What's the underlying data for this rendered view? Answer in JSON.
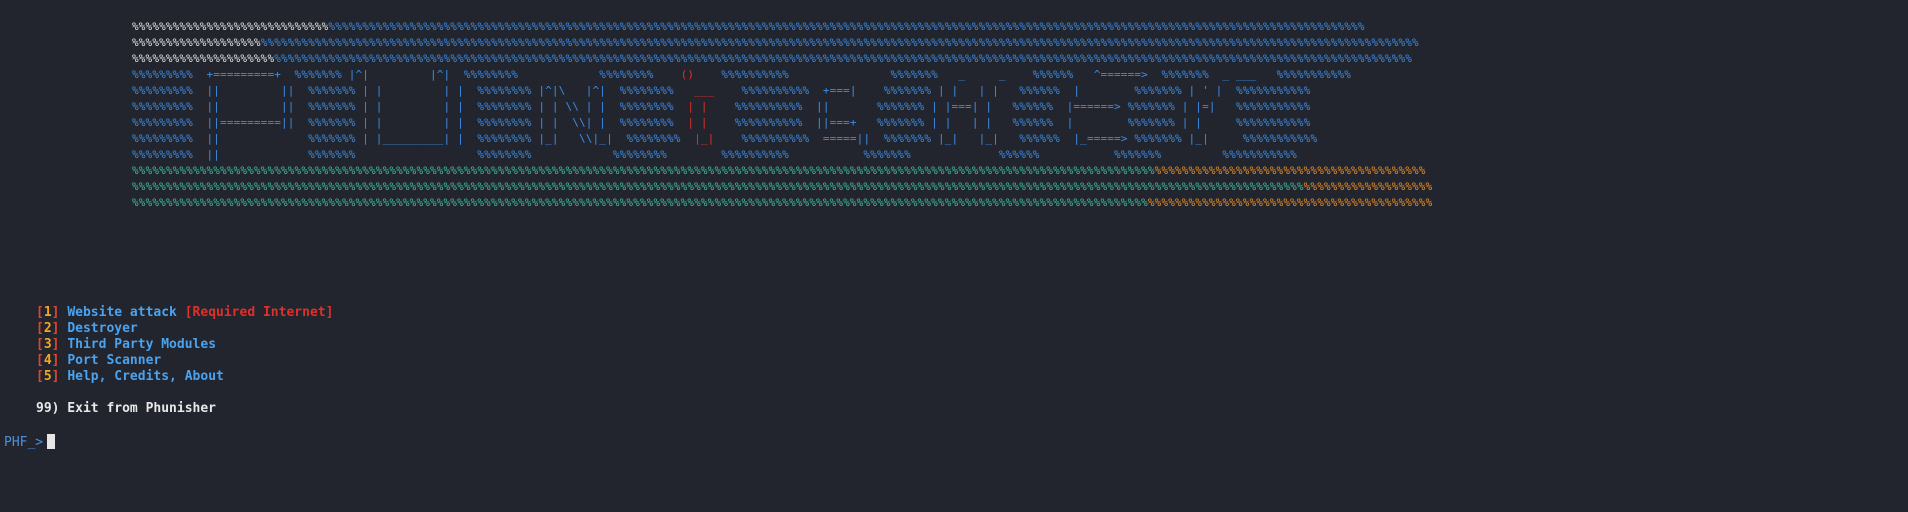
{
  "banner": {
    "colors": {
      "white": "#e6e6e6",
      "blue": "#3b8eea",
      "red": "#e0302a",
      "green": "#3fbf9f",
      "orange": "#f09020"
    },
    "rows": [
      [
        [
          "w",
          "%%%%%%%%%%%%%%%%%%%%%%%%%%%%%"
        ],
        [
          "b",
          "%%%%%%%%%%%%%%%%%%%%%%%%%%%%%%%%%%%%%%%%%%%%%%%%%%%%%%%%%%%%%%%%%%%%%%%%%%%%%%%%%%%%%%%%%%%%%%%%%%%%%%%%%%%%%%%%%%%%%%%%%%%%%%%%%%%%%%%%%%%%%%%%%%%%%%%%%"
        ]
      ],
      [
        [
          "w",
          "%%%%%%%%%%%%%%%%%%%"
        ],
        [
          "b",
          "%%%%%%%%%%%%%%%%%%%%%%%%%%%%%%%%%%%%%%%%%%%%%%%%%%%%%%%%%%%%%%%%%%%%%%%%%%%%%%%%%%%%%%%%%%%%%%%%%%%%%%%%%%%%%%%%%%%%%%%%%%%%%%%%%%%%%%%%%%%%%%%%%%%%%%%%%%%%%%%%%%%%%%%%%%%"
        ]
      ],
      [
        [
          "w",
          "%%%%%%%%%%%%%%%%%%%%%"
        ],
        [
          "b",
          "%%%%%%%%%%%%%%%%%%%%%%%%%%%%%%%%%%%%%%%%%%%%%%%%%%%%%%%%%%%%%%%%%%%%%%%%%%%%%%%%%%%%%%%%%%%%%%%%%%%%%%%%%%%%%%%%%%%%%%%%%%%%%%%%%%%%%%%%%%%%%%%%%%%%%%%%%%%%%%%%%%%%%%%%"
        ]
      ],
      [
        [
          "b",
          "%%%%%%%%%  +=========+  %%%%%%% |^|         |^|  %%%%%%%%            %%%%%%%%    "
        ],
        [
          "r",
          "()"
        ],
        [
          "b",
          "    %%%%%%%%%%   "
        ],
        [
          "b",
          "            %%%%%%%   _     _    %%%%%%   ^======>  %%%%%%%  _ ___   %%%%%%%%%%%"
        ]
      ],
      [
        [
          "b",
          "%%%%%%%%%  ||         ||  %%%%%%% | |         | |  %%%%%%%% |^|\\   |^|  %%%%%%%%   "
        ],
        [
          "r",
          "___"
        ],
        [
          "b",
          "    %%%%%%%%%%  +===|    %%%%%%% | |   | |   %%%%%%  |        %%%%%%% | ' |  %%%%%%%%%%%"
        ]
      ],
      [
        [
          "b",
          "%%%%%%%%%  ||         ||  %%%%%%% | |         | |  %%%%%%%% | | \\\\ | |  %%%%%%%%  "
        ],
        [
          "r",
          "| |"
        ],
        [
          "b",
          "    %%%%%%%%%%  ||       %%%%%%% | |===| |   %%%%%%  |======> %%%%%%% | |=|   %%%%%%%%%%%"
        ]
      ],
      [
        [
          "b",
          "%%%%%%%%%  ||=========||  %%%%%%% | |         | |  %%%%%%%% | |  \\\\| |  %%%%%%%%  "
        ],
        [
          "r",
          "| |"
        ],
        [
          "b",
          "    %%%%%%%%%%  ||===+   %%%%%%% | |   | |   %%%%%%  |        %%%%%%% | |     %%%%%%%%%%%"
        ]
      ],
      [
        [
          "b",
          "%%%%%%%%%  ||             %%%%%%% | |_________| |  %%%%%%%% |_|   \\\\|_|  %%%%%%%%  "
        ],
        [
          "r",
          "|_|"
        ],
        [
          "b",
          "    %%%%%%%%%%  =====||  %%%%%%% |_|   |_|   %%%%%%  |_=====> %%%%%%% |_|     %%%%%%%%%%%"
        ]
      ],
      [
        [
          "b",
          "%%%%%%%%%  ||             %%%%%%%                  %%%%%%%%            %%%%%%%%        %%%%%%%%%%           %%%%%%%             %%%%%%           %%%%%%%         %%%%%%%%%%%"
        ]
      ],
      [
        [
          "g",
          "%%%%%%%%%%%%%%%%%%%%%%%%%%%%%%%%%%%%%%%%%%%%%%%%%%%%%%%%%%%%%%%%%%%%%%%%%%%%%%%%%%%%%%%%%%%%%%%%%%%%%%%%%%%%%%%%%%%%%%%%%%%%%%%%%%%%%%%%%%%%%%%%%%%%%%%"
        ],
        [
          "o",
          "%%%%%%%%%%%%%%%%%%%%%%%%%%%%%%%%%%%%%%%%"
        ]
      ],
      [
        [
          "g",
          "%%%%%%%%%%%%%%%%%%%%%%%%%%%%%%%%%%%%%%%%%%%%%%%%%%%%%%%%%%%%%%%%%%%%%%%%%%%%%%%%%%%%%%%%%%%%%%%%%%%%%%%%%%%%%%%%%%%%%%%%%%%%%%%%%%%%%%%%%%%%%%%%%%%%%%%%%%%%%%%%%%%%%%%%%%%%%"
        ],
        [
          "o",
          "%%%%%%%%%%%%%%%%%%%"
        ]
      ],
      [
        [
          "g",
          "%%%%%%%%%%%%%%%%%%%%%%%%%%%%%%%%%%%%%%%%%%%%%%%%%%%%%%%%%%%%%%%%%%%%%%%%%%%%%%%%%%%%%%%%%%%%%%%%%%%%%%%%%%%%%%%%%%%%%%%%%%%%%%%%%%%%%%%%%%%%%%%%%%%%%%"
        ],
        [
          "o",
          "%%%%%%%%%%%%%%%%%%%%%%%%%%%%%%%%%%%%%%%%%%"
        ]
      ]
    ]
  },
  "menu": {
    "items": [
      {
        "number": "1",
        "label": "Website attack",
        "note": "[Required Internet]"
      },
      {
        "number": "2",
        "label": "Destroyer",
        "note": ""
      },
      {
        "number": "3",
        "label": "Third Party Modules",
        "note": ""
      },
      {
        "number": "4",
        "label": "Port Scanner",
        "note": ""
      },
      {
        "number": "5",
        "label": "Help, Credits, About",
        "note": ""
      }
    ],
    "exit_label": "99) Exit from Phunisher"
  },
  "prompt": {
    "text": "PHF_>"
  }
}
